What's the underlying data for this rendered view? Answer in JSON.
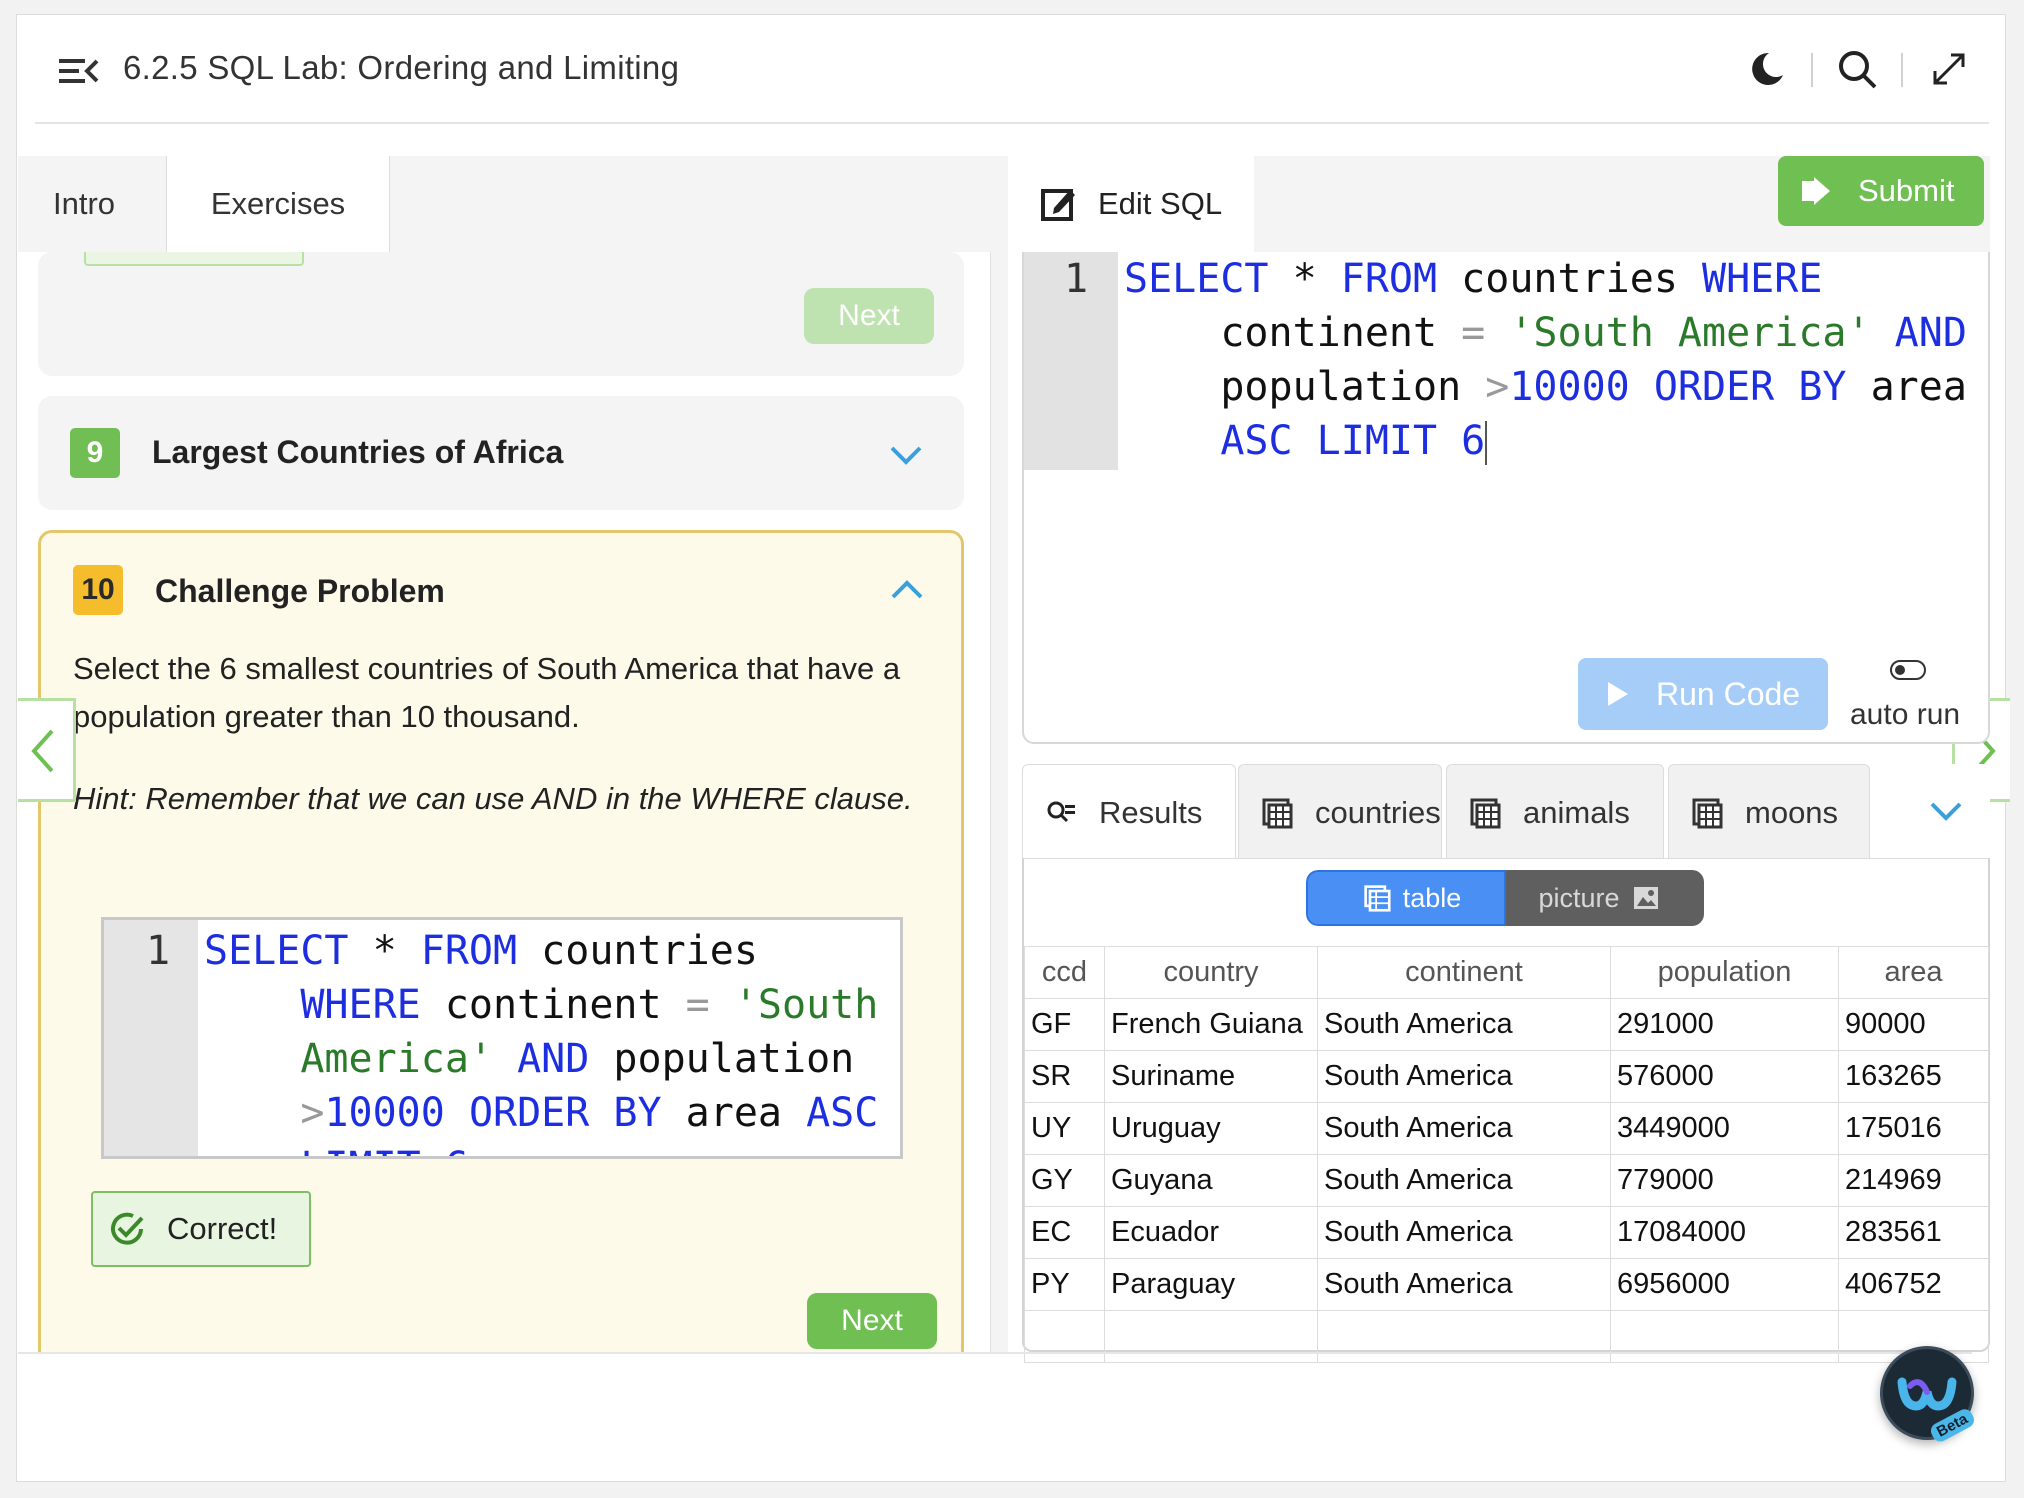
{
  "header": {
    "title": "6.2.5 SQL Lab: Ordering and Limiting",
    "icons": [
      "menu-collapse-icon",
      "moon-icon",
      "search-icon",
      "expand-icon"
    ]
  },
  "left_tabs": [
    "Intro",
    "Exercises"
  ],
  "exercises": {
    "prev_card": {
      "next_label": "Next"
    },
    "card9": {
      "number": "9",
      "title": "Largest Countries of Africa"
    },
    "card10": {
      "number": "10",
      "title": "Challenge Problem",
      "prompt": "Select the 6 smallest countries of South America that have a population greater than 10 thousand.",
      "hint": "Hint: Remember that we can use AND in the WHERE clause.",
      "line_number": "1",
      "correct_label": "Correct!",
      "next_label": "Next"
    }
  },
  "editor": {
    "tab_label": "Edit SQL",
    "submit_label": "Submit",
    "line_number": "1",
    "run_label": "Run Code",
    "auto_run_label": "auto run"
  },
  "results": {
    "tabs": [
      "Results",
      "countries",
      "animals",
      "moons"
    ],
    "view_table": "table",
    "view_picture": "picture",
    "columns": [
      "ccd",
      "country",
      "continent",
      "population",
      "area"
    ],
    "rows": [
      [
        "GF",
        "French Guiana",
        "South America",
        "291000",
        "90000"
      ],
      [
        "SR",
        "Suriname",
        "South America",
        "576000",
        "163265"
      ],
      [
        "UY",
        "Uruguay",
        "South America",
        "3449000",
        "175016"
      ],
      [
        "GY",
        "Guyana",
        "South America",
        "779000",
        "214969"
      ],
      [
        "EC",
        "Ecuador",
        "South America",
        "17084000",
        "283561"
      ],
      [
        "PY",
        "Paraguay",
        "South America",
        "6956000",
        "406752"
      ]
    ]
  },
  "assistant": {
    "beta_label": "Beta"
  },
  "colors": {
    "accent_green": "#6fbf52",
    "run_blue": "#a6cdf7",
    "keyword_blue": "#1c2ee0",
    "string_green": "#2a7a2a"
  }
}
